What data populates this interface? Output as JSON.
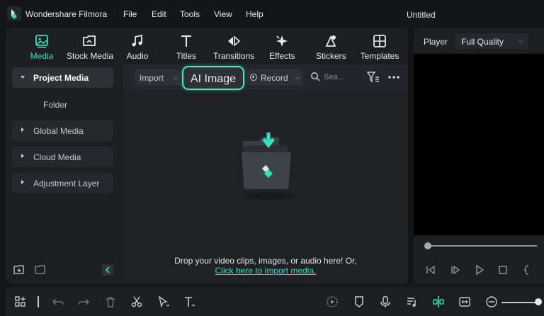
{
  "app": {
    "name": "Wondershare Filmora",
    "document_title": "Untitled"
  },
  "menu": [
    "File",
    "Edit",
    "Tools",
    "View",
    "Help"
  ],
  "tabs": [
    {
      "label": "Media",
      "icon": "media-icon",
      "active": true
    },
    {
      "label": "Stock Media",
      "icon": "stock-media-icon",
      "active": false
    },
    {
      "label": "Audio",
      "icon": "music-note-icon",
      "active": false
    },
    {
      "label": "Titles",
      "icon": "text-t-icon",
      "active": false
    },
    {
      "label": "Transitions",
      "icon": "transitions-icon",
      "active": false
    },
    {
      "label": "Effects",
      "icon": "effects-icon",
      "active": false
    },
    {
      "label": "Stickers",
      "icon": "stickers-icon",
      "active": false
    },
    {
      "label": "Templates",
      "icon": "templates-icon",
      "active": false
    }
  ],
  "sidebar": {
    "items": [
      {
        "label": "Project Media",
        "active": true
      },
      {
        "label": "Folder"
      },
      {
        "label": "Global Media"
      },
      {
        "label": "Cloud Media"
      },
      {
        "label": "Adjustment Layer"
      }
    ]
  },
  "content_toolbar": {
    "import_label": "Import",
    "ai_image_label": "AI Image",
    "record_label": "Record",
    "search_placeholder": "Sea..."
  },
  "drop_zone": {
    "message": "Drop your video clips, images, or audio here! Or,",
    "link": "Click here to import media."
  },
  "player": {
    "label": "Player",
    "quality": "Full Quality",
    "progress": 0
  },
  "colors": {
    "accent": "#35e0c0",
    "background": "#141619",
    "panel": "#1c1e22"
  }
}
